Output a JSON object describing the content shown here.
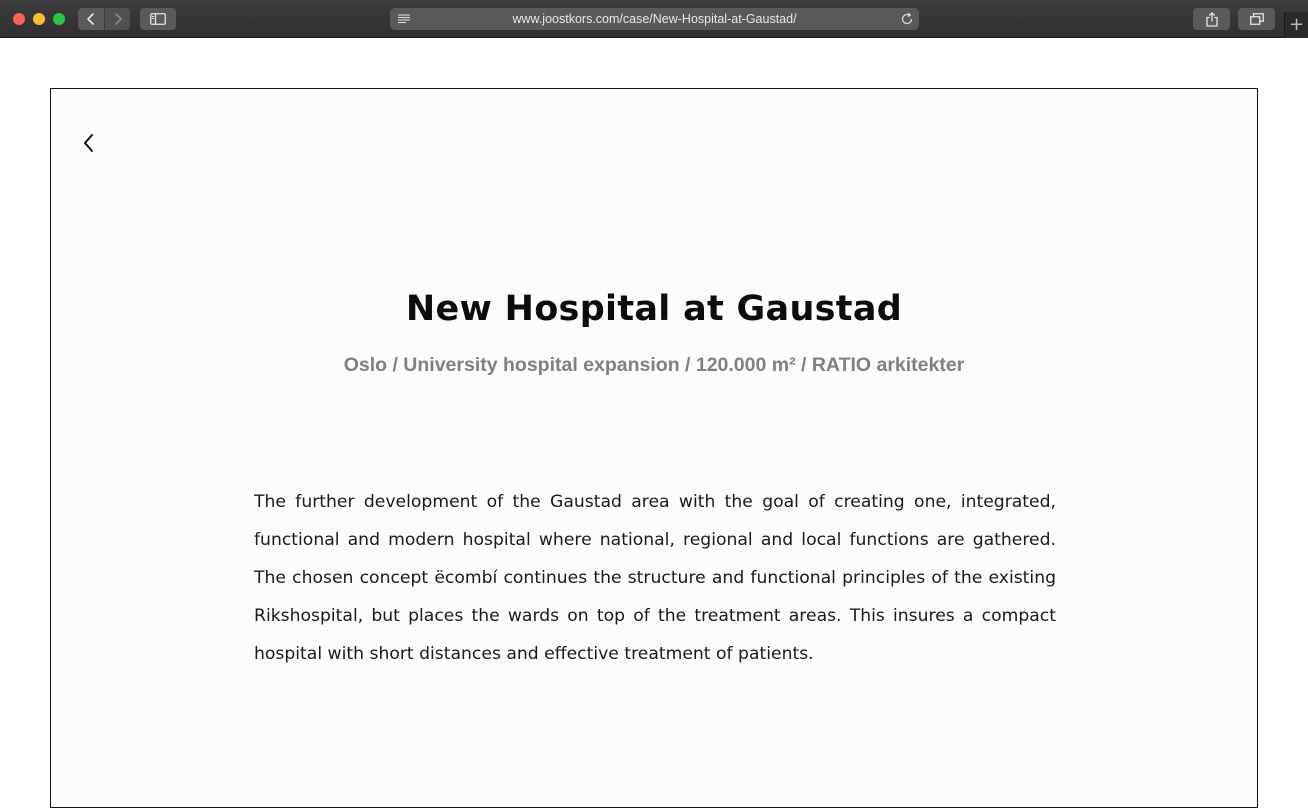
{
  "browser": {
    "url": "www.joostkors.com/case/New-Hospital-at-Gaustad/",
    "new_tab_label": "+"
  },
  "case": {
    "title": "New Hospital at Gaustad",
    "subtitle": "Oslo / University hospital expansion / 120.000 m² / RATIO arkitekter",
    "description": "The further development of the Gaustad area with the goal of creating one, integrated, functional and modern hospital where national, regional and local functions are gathered. The chosen concept ëcombí continues the structure and functional principles of the existing Rikshospital, but places the wards on top of the treatment areas. This insures a compact hospital with short distances and effective treatment of patients."
  },
  "icons": {
    "back": "chevron-left-icon",
    "forward": "chevron-right-icon",
    "sidebar": "sidebar-icon",
    "reader": "reader-icon",
    "reload": "reload-icon",
    "share": "share-icon",
    "tabs": "tabs-icon",
    "page_back": "chevron-left-icon"
  }
}
